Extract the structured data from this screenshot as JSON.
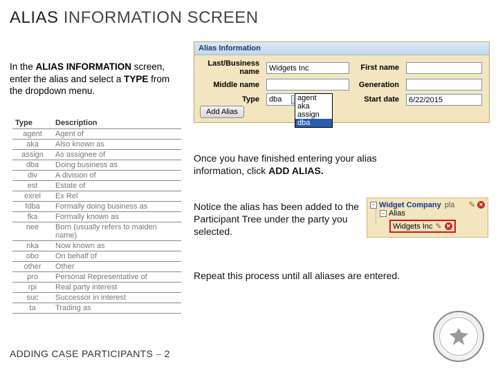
{
  "title_part1": "ALIAS",
  "title_part2": "INFORMATION SCREEN",
  "intro_prefix": "In the ",
  "intro_bold1": "ALIAS INFORMATION",
  "intro_mid": " screen, enter the alias and select a ",
  "intro_bold2": "TYPE",
  "intro_suffix": " from the dropdown menu.",
  "panel": {
    "header": "Alias Information",
    "labels": {
      "last": "Last/Business name",
      "first": "First name",
      "middle": "Middle name",
      "generation": "Generation",
      "type": "Type",
      "start": "Start date"
    },
    "values": {
      "last": "Widgets Inc",
      "first": "",
      "middle": "",
      "generation": "",
      "type_selected": "dba",
      "start": "6/22/2015"
    },
    "dropdown": [
      "agent",
      "aka",
      "assign",
      "dba"
    ],
    "add_button": "Add Alias"
  },
  "table": {
    "headers": {
      "c1": "Type",
      "c2": "Description"
    },
    "rows": [
      {
        "c1": "agent",
        "c2": "Agent of"
      },
      {
        "c1": "aka",
        "c2": "Also known as"
      },
      {
        "c1": "assign",
        "c2": "As assignee of"
      },
      {
        "c1": "dba",
        "c2": "Doing business as"
      },
      {
        "c1": "div",
        "c2": "A division of"
      },
      {
        "c1": "est",
        "c2": "Estate of"
      },
      {
        "c1": "exrel",
        "c2": "Ex Rel"
      },
      {
        "c1": "fdba",
        "c2": "Formally doing business as"
      },
      {
        "c1": "fka",
        "c2": "Formally known as"
      },
      {
        "c1": "nee",
        "c2": "Born (usually refers to maiden name)"
      },
      {
        "c1": "nka",
        "c2": "Now known as"
      },
      {
        "c1": "obo",
        "c2": "On behalf of"
      },
      {
        "c1": "other",
        "c2": "Other"
      },
      {
        "c1": "pro",
        "c2": "Personal Representative of"
      },
      {
        "c1": "rpi",
        "c2": "Real party interest"
      },
      {
        "c1": "suc",
        "c2": "Successor in interest"
      },
      {
        "c1": "ta",
        "c2": "Trading as"
      }
    ]
  },
  "para1_a": "Once you have finished entering your alias information, click ",
  "para1_b": "ADD ALIAS.",
  "para2": "Notice the alias has been added to the Participant Tree under the party you selected.",
  "para3": "Repeat this process until all aliases are entered.",
  "tree": {
    "root": "Widget Company",
    "root_suffix": "pla",
    "alias_label": "Alias",
    "leaf": "Widgets Inc"
  },
  "footer_a": "ADDING CASE PARTICIPANTS ",
  "footer_sep": "–",
  "footer_b": " 2"
}
